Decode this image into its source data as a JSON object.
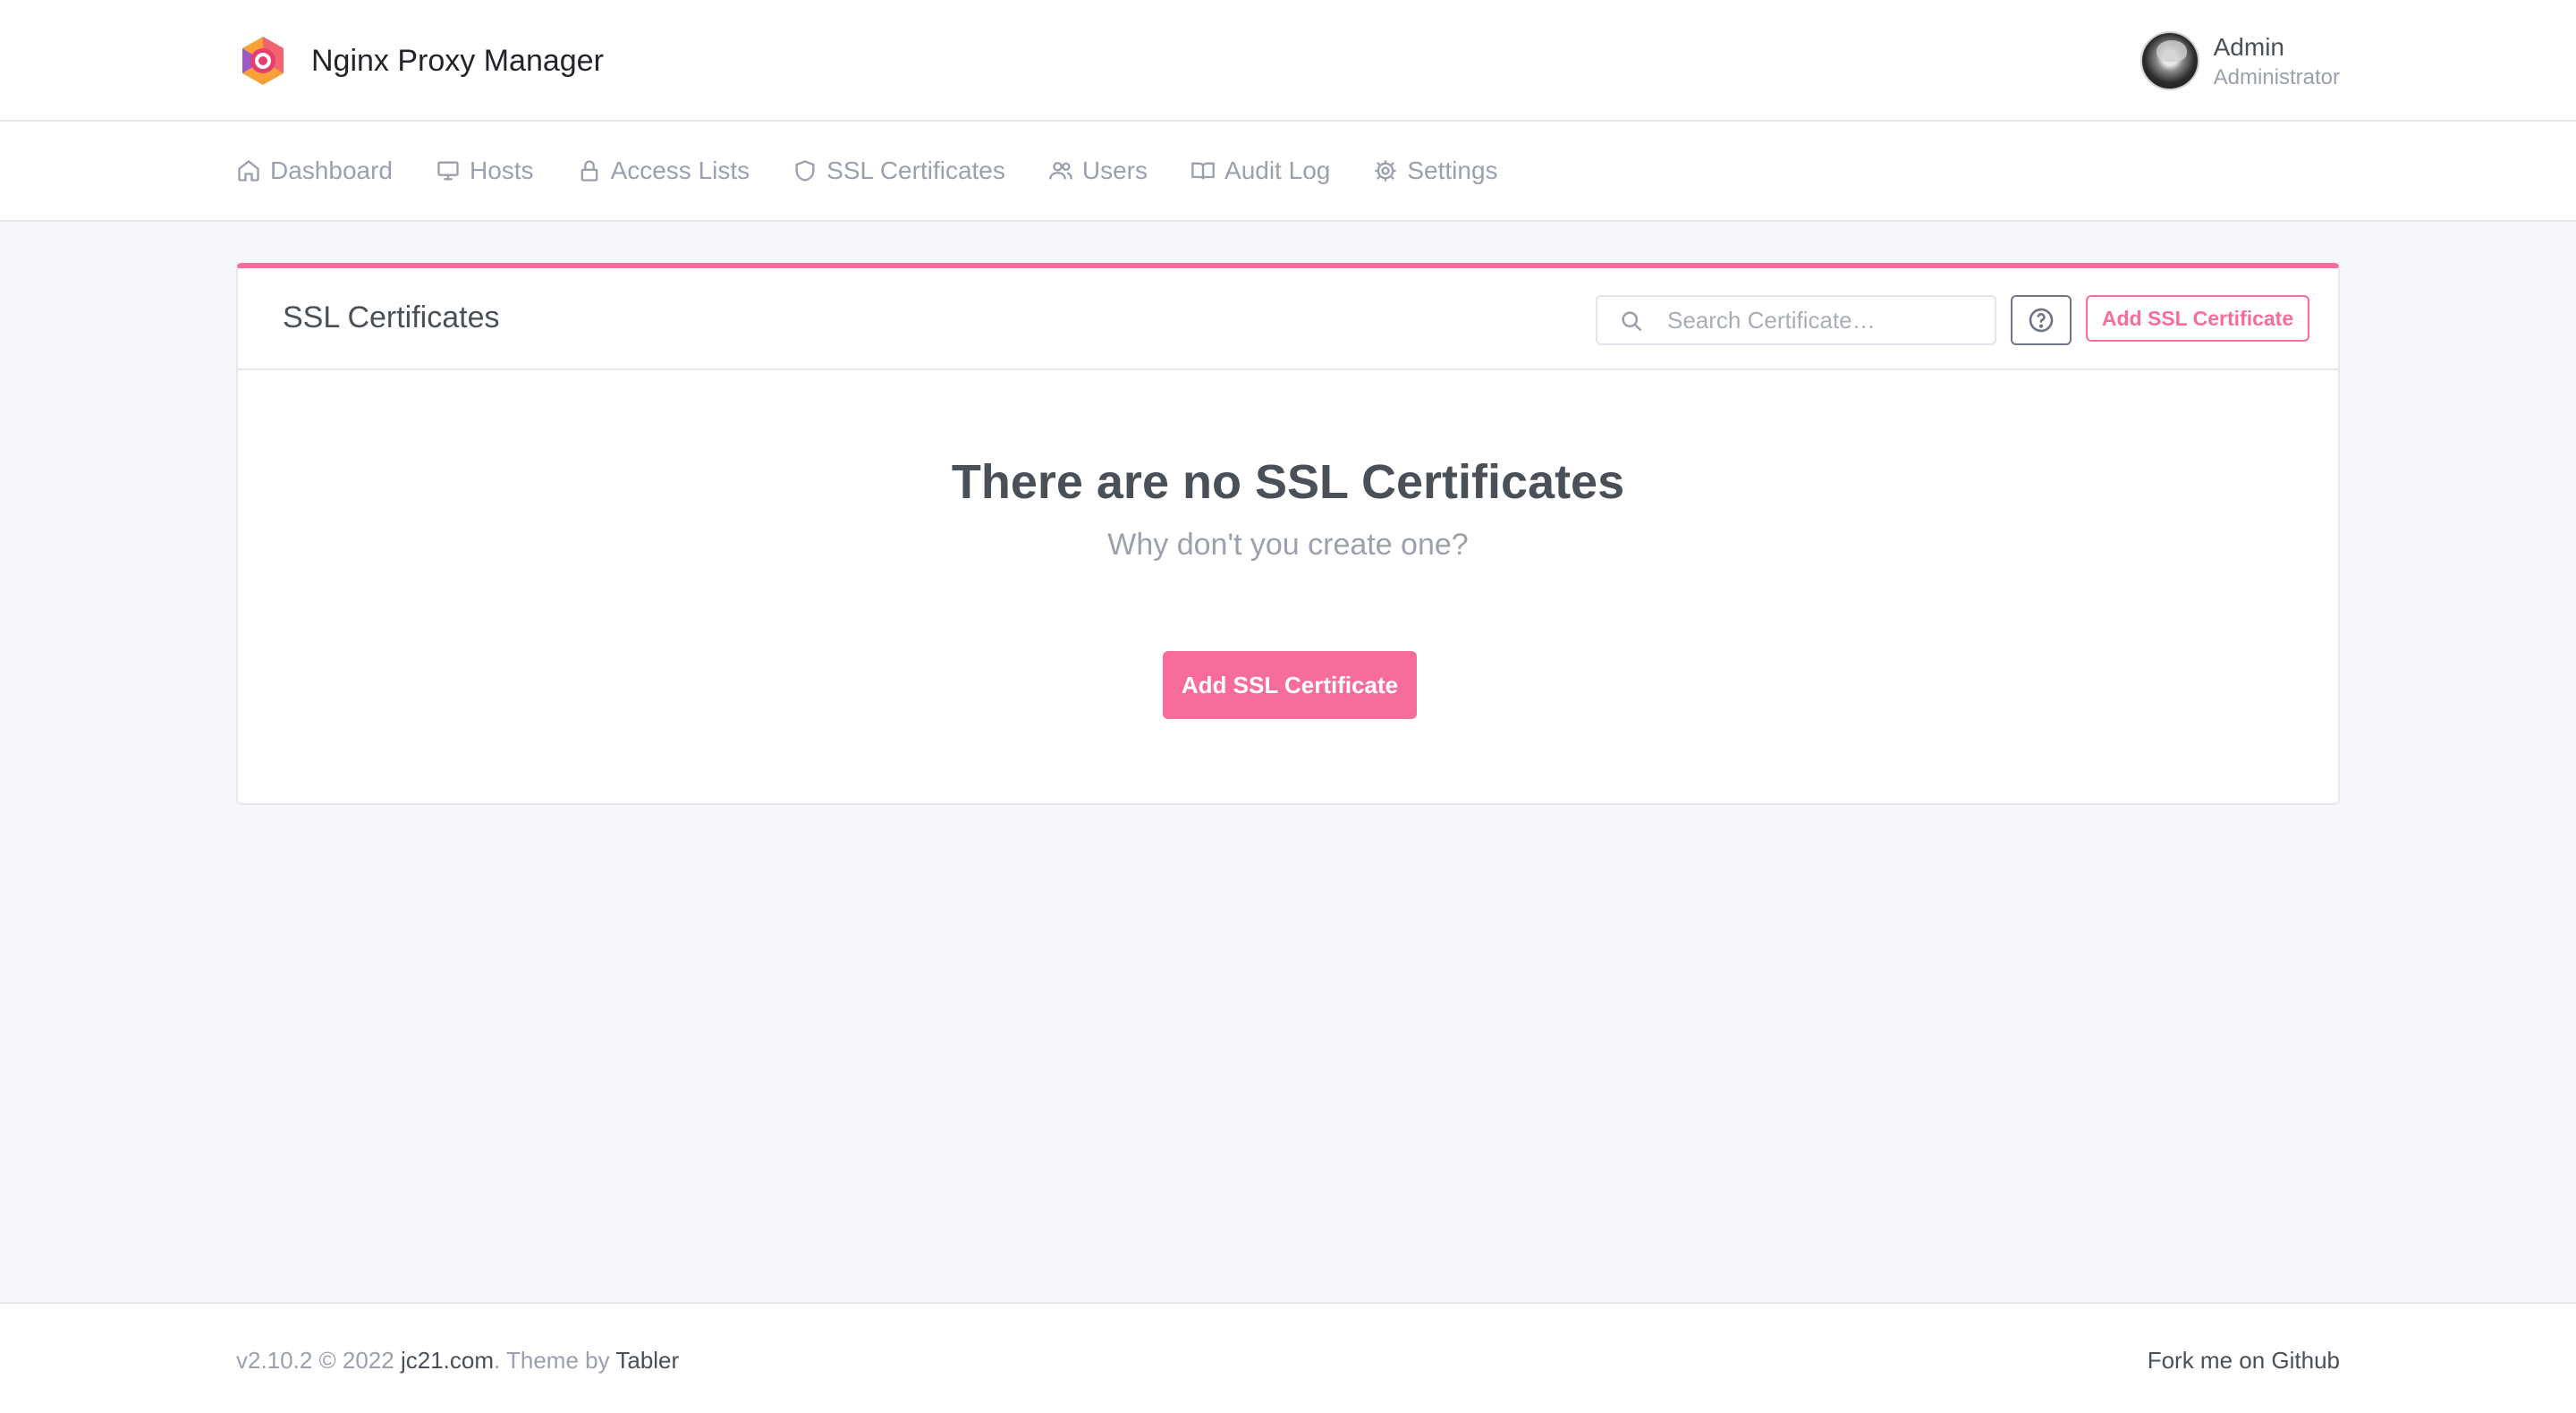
{
  "app": {
    "name": "Nginx Proxy Manager",
    "logo_icon": "nginx-proxy-manager-logo"
  },
  "user": {
    "name": "Admin",
    "role": "Administrator"
  },
  "nav": {
    "items": [
      {
        "label": "Dashboard",
        "icon": "home-icon"
      },
      {
        "label": "Hosts",
        "icon": "monitor-icon"
      },
      {
        "label": "Access Lists",
        "icon": "lock-icon"
      },
      {
        "label": "SSL Certificates",
        "icon": "shield-icon"
      },
      {
        "label": "Users",
        "icon": "users-icon"
      },
      {
        "label": "Audit Log",
        "icon": "book-icon"
      },
      {
        "label": "Settings",
        "icon": "gear-icon"
      }
    ]
  },
  "card": {
    "title": "SSL Certificates",
    "search_placeholder": "Search Certificate…",
    "add_button_label": "Add SSL Certificate",
    "empty_title": "There are no SSL Certificates",
    "empty_subtitle": "Why don't you create one?",
    "empty_button_label": "Add SSL Certificate"
  },
  "footer": {
    "version": "v2.10.2 © 2022 ",
    "company_link": "jc21.com",
    "theme_prefix": ". Theme by ",
    "theme_link": "Tabler",
    "fork_label": "Fork me on Github"
  },
  "colors": {
    "accent": "#f66d9b",
    "text": "#495057",
    "muted": "#9aa0ac",
    "background": "#f5f7fb"
  }
}
